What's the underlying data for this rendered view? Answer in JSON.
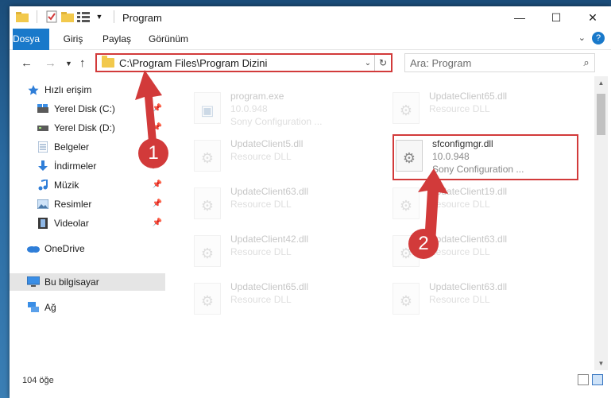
{
  "window": {
    "title": "Program"
  },
  "ribbon": {
    "tabs": [
      "Dosya",
      "Giriş",
      "Paylaş",
      "Görünüm"
    ]
  },
  "nav": {
    "address": "C:\\Program Files\\Program Dizini",
    "search_placeholder": "Ara: Program"
  },
  "sidebar": {
    "items": [
      {
        "label": "Hızlı erişim"
      },
      {
        "label": "Yerel Disk (C:)"
      },
      {
        "label": "Yerel Disk (D:)"
      },
      {
        "label": "Belgeler"
      },
      {
        "label": "İndirmeler"
      },
      {
        "label": "Müzik"
      },
      {
        "label": "Resimler"
      },
      {
        "label": "Videolar"
      },
      {
        "label": "OneDrive"
      },
      {
        "label": "Bu bilgisayar"
      },
      {
        "label": "Ağ"
      }
    ]
  },
  "files": [
    {
      "name": "program.exe",
      "line2": "10.0.948",
      "line3": "Sony Configuration ..."
    },
    {
      "name": "UpdateClient65.dll",
      "line2": "Resource DLL"
    },
    {
      "name": "UpdateClient5.dll",
      "line2": "Resource DLL"
    },
    {
      "name": "sfconfigmgr.dll",
      "line2": "10.0.948",
      "line3": "Sony Configuration ..."
    },
    {
      "name": "UpdateClient63.dll",
      "line2": "Resource DLL"
    },
    {
      "name": "UpdateClient19.dll",
      "line2": "Resource DLL"
    },
    {
      "name": "UpdateClient42.dll",
      "line2": "Resource DLL"
    },
    {
      "name": "UpdateClient63.dll",
      "line2": "Resource DLL"
    },
    {
      "name": "UpdateClient65.dll",
      "line2": "Resource DLL"
    },
    {
      "name": "UpdateClient63.dll",
      "line2": "Resource DLL"
    }
  ],
  "status": {
    "count": "104 öğe"
  },
  "annotations": {
    "badge1": "1",
    "badge2": "2",
    "color": "#d23a3a"
  }
}
